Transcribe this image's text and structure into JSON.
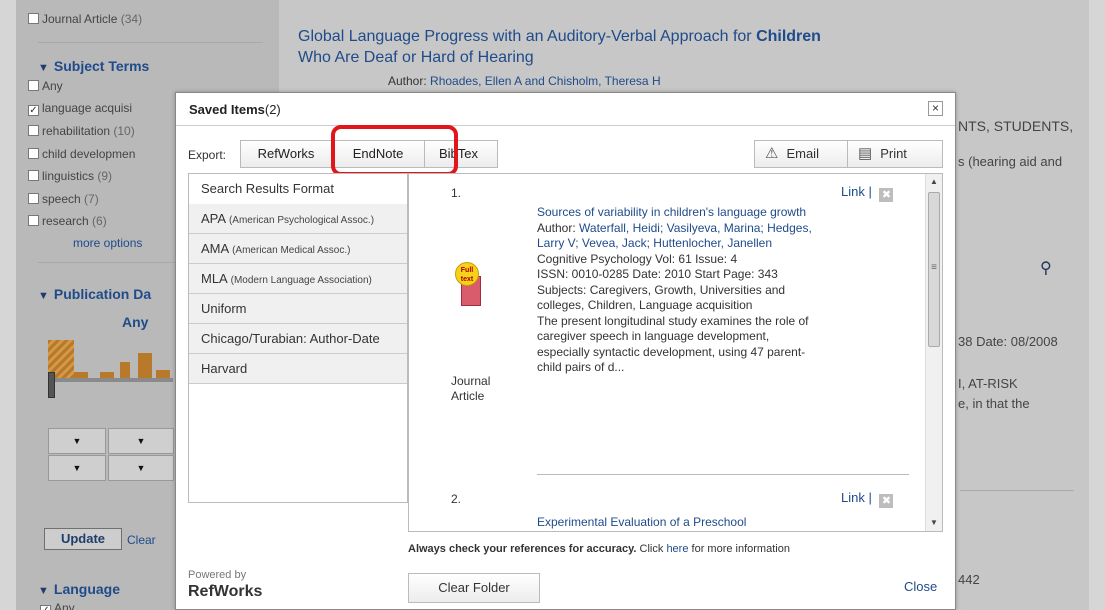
{
  "sidebar": {
    "doc_type_item": {
      "label": "Journal Article",
      "count": "(34)"
    },
    "subject_terms": {
      "heading": "Subject Terms",
      "items": [
        {
          "label": "Any",
          "count": "",
          "checked": false
        },
        {
          "label": "language acquisi",
          "count": "",
          "checked": true
        },
        {
          "label": "rehabilitation",
          "count": "(10)",
          "checked": false
        },
        {
          "label": "child developmen",
          "count": "",
          "checked": false
        },
        {
          "label": "linguistics",
          "count": "(9)",
          "checked": false
        },
        {
          "label": "speech",
          "count": "(7)",
          "checked": false
        },
        {
          "label": "research",
          "count": "(6)",
          "checked": false
        }
      ],
      "more_options": "more options"
    },
    "publication_date": {
      "heading": "Publication Da",
      "value": "Any"
    },
    "update_button": "Update",
    "clear_link": "Clear",
    "language": {
      "heading": "Language",
      "item": "Any"
    }
  },
  "main": {
    "result_title_part1": "Global Language Progress with an Auditory-Verbal Approach for ",
    "result_title_bold": "Children",
    "result_title_part2": "Who Are Deaf or Hard of Hearing",
    "author_label": "Author: ",
    "authors": "Rhoades, Ellen A and Chisholm, Theresa H",
    "snippets": {
      "students": "NTS, STUDENTS,",
      "hearing": "s (hearing aid and",
      "date": "38 Date: 08/2008",
      "at_risk": "I, AT-RISK",
      "in_that": "e, in that the",
      "num": "442"
    }
  },
  "modal": {
    "title": "Saved Items",
    "count": "(2)",
    "close_symbol": "×",
    "export_label": "Export:",
    "tabs": [
      "RefWorks",
      "EndNote",
      "BibTex"
    ],
    "email_label": "Email",
    "print_label": "Print",
    "formats": [
      {
        "name": "Search Results Format",
        "sub": ""
      },
      {
        "name": "APA",
        "sub": "(American Psychological Assoc.)"
      },
      {
        "name": "AMA",
        "sub": "(American Medical Assoc.)"
      },
      {
        "name": "MLA",
        "sub": "(Modern Language Association)"
      },
      {
        "name": "Uniform",
        "sub": ""
      },
      {
        "name": "Chicago/Turabian: Author-Date",
        "sub": ""
      },
      {
        "name": "Harvard",
        "sub": ""
      }
    ],
    "results": [
      {
        "num": "1.",
        "link": "Link",
        "title": "Sources of variability in children's language growth",
        "author_label": "Author: ",
        "authors": "Waterfall, Heidi; Vasilyeva, Marina; Hedges, Larry V; Vevea, Jack; Huttenlocher, Janellen",
        "source": "Cognitive Psychology Vol: 61 Issue: 4",
        "issn": "ISSN: 0010-0285 Date: 2010 Start Page: 343",
        "subjects": "Subjects: Caregivers, Growth, Universities and colleges, Children, Language acquisition",
        "abstract": "The present longitudinal study examines the role of caregiver speech in language development, especially syntactic development, using 47 parent-child pairs of d...",
        "type_line1": "Journal",
        "type_line2": "Article",
        "badge": "Full text"
      },
      {
        "num": "2.",
        "link": "Link",
        "title": "Experimental Evaluation of a Preschool"
      }
    ],
    "accuracy_bold": "Always check your references for accuracy.",
    "accuracy_rest": " Click ",
    "accuracy_link": "here",
    "accuracy_end": " for more information",
    "powered_by": "Powered by",
    "brand": "RefWorks",
    "clear_folder": "Clear Folder",
    "close_link": "Close"
  },
  "colors": {
    "highlight": "#e0161b",
    "link": "#1f4b8a",
    "overlay": "#b9b9b9"
  }
}
